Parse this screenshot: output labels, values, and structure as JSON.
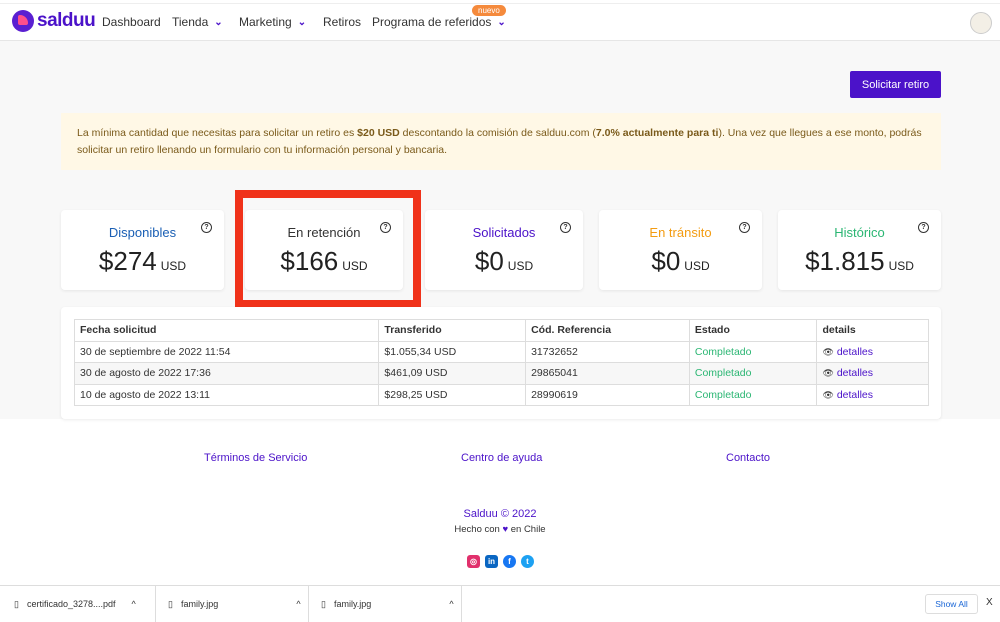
{
  "nav": {
    "brand": "salduu",
    "items": [
      {
        "label": "Dashboard"
      },
      {
        "label": "Tienda"
      },
      {
        "label": "Marketing"
      },
      {
        "label": "Retiros"
      },
      {
        "label": "Programa de referidos"
      }
    ],
    "badge": "nuevo"
  },
  "actions": {
    "request": "Solicitar retiro"
  },
  "alert": {
    "p1": "La mínima cantidad que necesitas para solicitar un retiro es ",
    "b1": "$20 USD",
    "p2": " descontando la comisión de salduu.com (",
    "b2": "7.0% actualmente para ti",
    "p3": "). Una vez que llegues a ese monto, podrás solicitar un retiro llenando un formulario con tu información personal y bancaria."
  },
  "cards": [
    {
      "title": "Disponibles",
      "value": "$274",
      "unit": "USD",
      "color": "#1a5fb4"
    },
    {
      "title": "En retención",
      "value": "$166",
      "unit": "USD",
      "color": "#333333"
    },
    {
      "title": "Solicitados",
      "value": "$0",
      "unit": "USD",
      "color": "#4b12c9"
    },
    {
      "title": "En tránsito",
      "value": "$0",
      "unit": "USD",
      "color": "#f39c12"
    },
    {
      "title": "Histórico",
      "value": "$1.815",
      "unit": "USD",
      "color": "#2bb673"
    }
  ],
  "help": "?",
  "table": {
    "headers": [
      "Fecha solicitud",
      "Transferido",
      "Cód. Referencia",
      "Estado",
      "details"
    ],
    "rows": [
      [
        "30 de septiembre de 2022 11:54",
        "$1.055,34 USD",
        "31732652",
        "Completado",
        "detalles"
      ],
      [
        "30 de agosto de 2022 17:36",
        "$461,09 USD",
        "29865041",
        "Completado",
        "detalles"
      ],
      [
        "10 de agosto de 2022 13:11",
        "$298,25 USD",
        "28990619",
        "Completado",
        "detalles"
      ]
    ]
  },
  "footer": {
    "links": [
      "Términos de Servicio",
      "Centro de ayuda",
      "Contacto"
    ],
    "copyright": "Salduu © 2022",
    "made_pre": "Hecho con",
    "made_post": "en Chile"
  },
  "downloads": {
    "items": [
      "certificado_3278....pdf",
      "family.jpg",
      "family.jpg"
    ],
    "show_all": "Show All",
    "close": "X"
  }
}
